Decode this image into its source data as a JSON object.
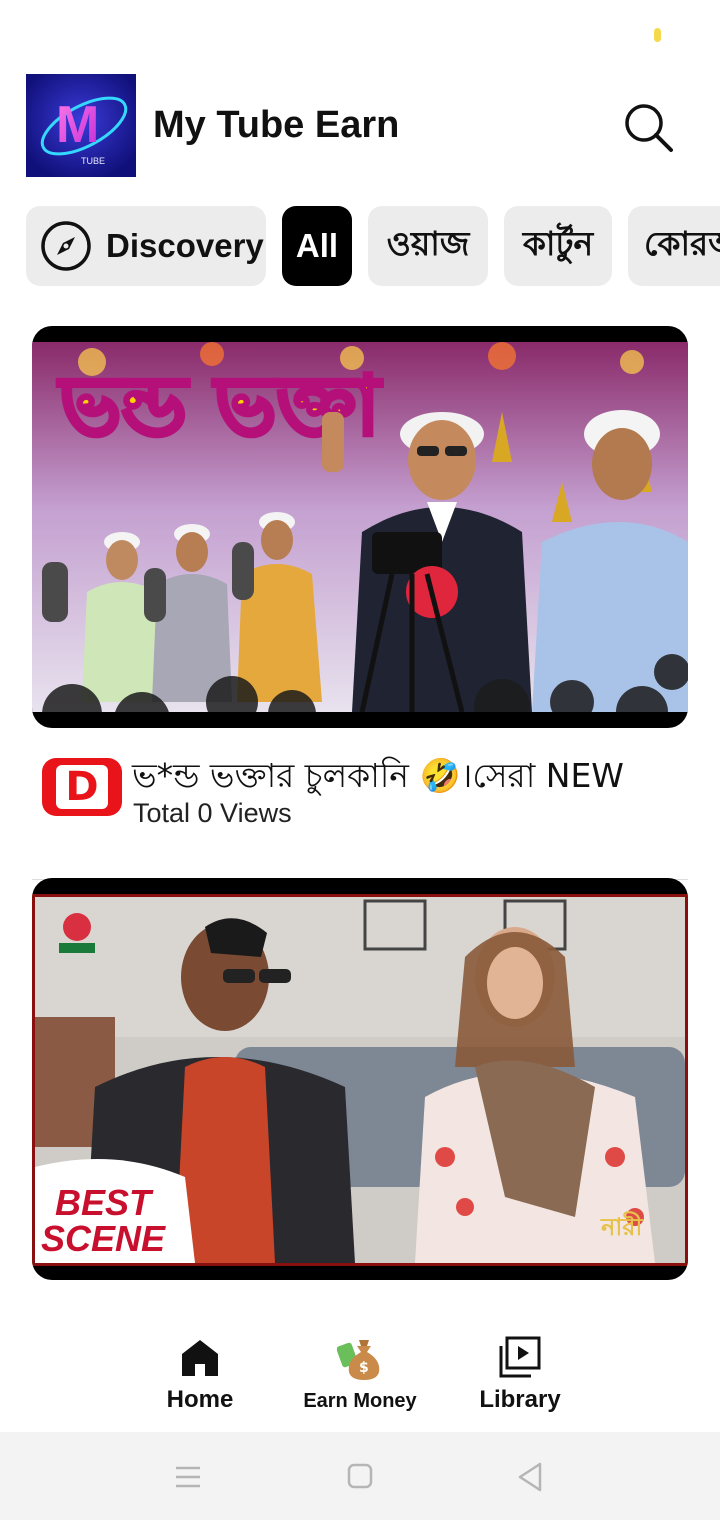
{
  "app": {
    "title": "My Tube Earn",
    "logo_text": "M",
    "logo_subtext": "TUBE",
    "brand_colors": {
      "logo_bg": "#1a1a8c",
      "logo_accent": "#ff4fd8"
    }
  },
  "header": {
    "search_icon": "search-icon"
  },
  "chips": [
    {
      "label": "Discovery",
      "icon": "compass-icon",
      "active": false
    },
    {
      "label": "All",
      "active": true
    },
    {
      "label": "ওয়াজ",
      "active": false
    },
    {
      "label": "কার্টুন",
      "active": false
    },
    {
      "label": "কোরআ",
      "active": false
    }
  ],
  "videos": [
    {
      "thumbnail_text": "ভন্ড ভক্তা",
      "channel_avatar_letter": "D",
      "title": "ভ*ন্ড ভক্তার চুলকানি 🤣।সেরা NEW",
      "views": "Total 0 Views"
    },
    {
      "thumbnail_text_line1": "BEST",
      "thumbnail_text_line2": "SCENE",
      "thumbnail_corner_text": "নারী"
    }
  ],
  "bottom_nav": {
    "home": {
      "label": "Home",
      "icon": "home-icon"
    },
    "earn": {
      "label": "Earn Money",
      "icon": "money-bag-icon"
    },
    "library": {
      "label": "Library",
      "icon": "library-icon"
    }
  },
  "system_nav": {
    "icons": [
      "menu-icon",
      "home-square-icon",
      "back-triangle-icon"
    ]
  },
  "colors": {
    "chip_bg": "#ececec",
    "chip_active_bg": "#000000",
    "channel_avatar": "#e8141a",
    "status_dot": "#f6d94a"
  }
}
